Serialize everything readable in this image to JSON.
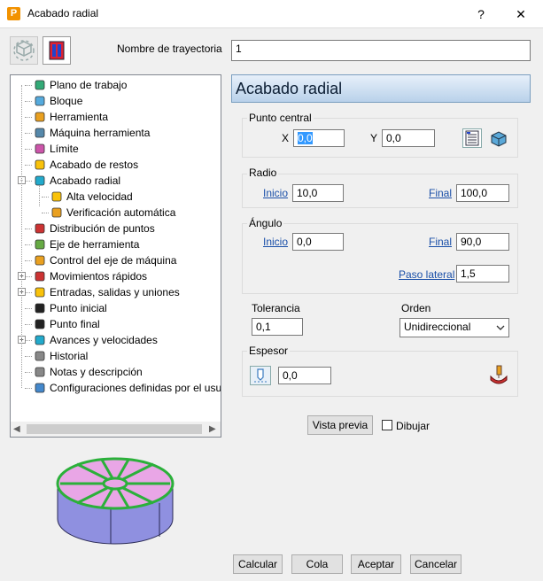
{
  "window": {
    "title": "Acabado radial",
    "help": "?",
    "close": "✕",
    "app_letter": "P"
  },
  "toolpath_name": {
    "label": "Nombre de trayectoria",
    "value": "1"
  },
  "tree": {
    "items": [
      {
        "label": "Plano de trabajo",
        "icon": "workplane-icon"
      },
      {
        "label": "Bloque",
        "icon": "block-icon"
      },
      {
        "label": "Herramienta",
        "icon": "tool-icon"
      },
      {
        "label": "Máquina herramienta",
        "icon": "machine-tool-icon"
      },
      {
        "label": "Límite",
        "icon": "boundary-icon"
      },
      {
        "label": "Acabado de restos",
        "icon": "rest-finishing-icon"
      },
      {
        "label": "Acabado radial",
        "icon": "radial-finishing-icon"
      },
      {
        "label": "Alta velocidad",
        "icon": "high-speed-icon"
      },
      {
        "label": "Verificación automática",
        "icon": "auto-verify-icon"
      },
      {
        "label": "Distribución de puntos",
        "icon": "point-distribution-icon"
      },
      {
        "label": "Eje de herramienta",
        "icon": "tool-axis-icon"
      },
      {
        "label": "Control del eje de máquina",
        "icon": "axis-control-icon"
      },
      {
        "label": "Movimientos rápidos",
        "icon": "rapid-moves-icon"
      },
      {
        "label": "Entradas, salidas y uniones",
        "icon": "leads-links-icon"
      },
      {
        "label": "Punto inicial",
        "icon": "start-point-icon"
      },
      {
        "label": "Punto final",
        "icon": "end-point-icon"
      },
      {
        "label": "Avances y velocidades",
        "icon": "feeds-speeds-icon"
      },
      {
        "label": "Historial",
        "icon": "history-icon"
      },
      {
        "label": "Notas y descripción",
        "icon": "notes-icon"
      },
      {
        "label": "Configuraciones definidas por el usu",
        "icon": "user-defined-icon"
      }
    ]
  },
  "page": {
    "header": "Acabado radial",
    "center": {
      "label": "Punto central",
      "x_label": "X",
      "x_value": "0,0",
      "y_label": "Y",
      "y_value": "0,0"
    },
    "radius": {
      "label": "Radio",
      "start_label": "Inicio",
      "start_value": "10,0",
      "end_label": "Final",
      "end_value": "100,0"
    },
    "angle": {
      "label": "Ángulo",
      "start_label": "Inicio",
      "start_value": "0,0",
      "end_label": "Final",
      "end_value": "90,0",
      "stepover_label": "Paso lateral",
      "stepover_value": "1,5"
    },
    "tolerance": {
      "label": "Tolerancia",
      "value": "0,1"
    },
    "order": {
      "label": "Orden",
      "value": "Unidireccional"
    },
    "thickness": {
      "label": "Espesor",
      "value": "0,0"
    },
    "preview_button": "Vista previa",
    "draw_label": "Dibujar"
  },
  "footer": {
    "calculate": "Calcular",
    "queue": "Cola",
    "accept": "Aceptar",
    "cancel": "Cancelar"
  },
  "colors": {
    "accent_blue": "#1a4fa8",
    "preview_top": "#e9a6e6",
    "preview_side": "#8f90e0",
    "preview_lines": "#2bb03a"
  }
}
